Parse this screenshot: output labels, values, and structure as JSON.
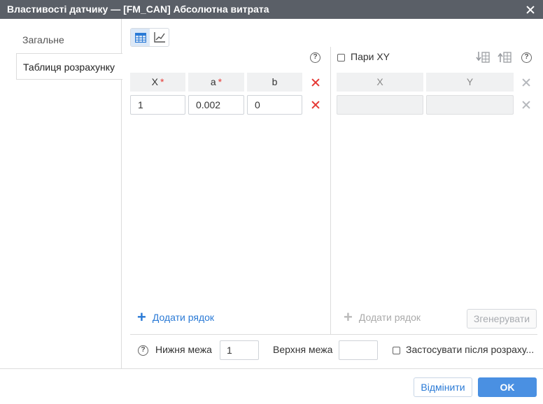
{
  "window": {
    "title": "Властивості датчику — [FM_CAN] Абсолютна витрата"
  },
  "sidebar": {
    "items": [
      {
        "label": "Загальне"
      },
      {
        "label": "Таблиця розрахунку"
      }
    ]
  },
  "left_table": {
    "columns": [
      {
        "label": "X",
        "required": true
      },
      {
        "label": "a",
        "required": true
      },
      {
        "label": "b",
        "required": false
      }
    ],
    "rows": [
      {
        "x": "1",
        "a": "0.002",
        "b": "0"
      }
    ],
    "add_row_label": "Додати рядок"
  },
  "right_table": {
    "pairs_label": "Пари XY",
    "columns": [
      {
        "label": "X"
      },
      {
        "label": "Y"
      }
    ],
    "add_row_label": "Додати рядок",
    "generate_label": "Згенерувати"
  },
  "bounds": {
    "lower_label": "Нижня межа",
    "lower_value": "1",
    "upper_label": "Верхня межа",
    "upper_value": "",
    "apply_label": "Застосувати після розраху..."
  },
  "footer": {
    "cancel_label": "Відмінити",
    "ok_label": "OK"
  },
  "icons": {
    "help": "?"
  },
  "colors": {
    "accent": "#4a90e2",
    "title_bar": "#5a5f67",
    "required": "#e53935"
  }
}
